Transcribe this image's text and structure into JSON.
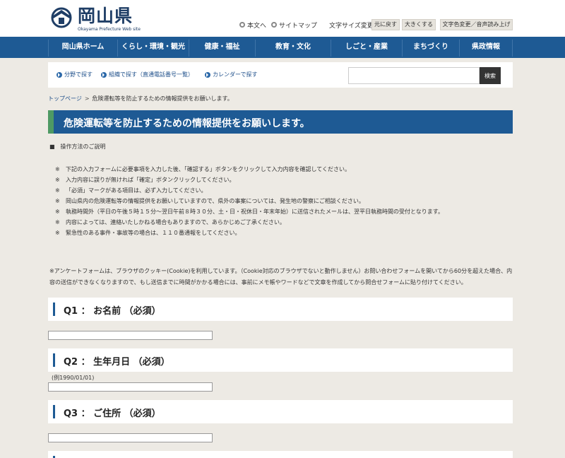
{
  "header": {
    "logo_title": "岡山県",
    "logo_subtitle": "Okayama Prefecture Web site",
    "links": {
      "main_text": "本文へ",
      "sitemap": "サイトマップ"
    },
    "font_size_label": "文字サイズ変更",
    "buttons": {
      "reset": "元に戻す",
      "enlarge": "大きくする",
      "color_voice": "文字色変更／音声読み上げ"
    }
  },
  "nav": [
    "岡山県ホーム",
    "くらし・環境・観光",
    "健康・福祉",
    "教育・文化",
    "しごと・産業",
    "まちづくり",
    "県政情報"
  ],
  "search": {
    "links": [
      "分野で探す",
      "組織で探す（直通電話番号一覧）",
      "カレンダーで探す"
    ],
    "placeholder": "",
    "button": "検索"
  },
  "breadcrumb": {
    "home": "トップページ",
    "separator": ">",
    "current": "危険運転等を防止するための情報提供をお願いします。"
  },
  "title": "危険運転等を防止するための情報提供をお願いします。",
  "instructions": {
    "heading": "■　操作方法のご説明",
    "mark": "※",
    "notes": [
      "下記の入力フォームに必要事項を入力した後、「確認する」ボタンをクリックして入力内容を確認してください。",
      "入力内容に誤りが無ければ「確定」ボタンクリックしてください。",
      "「必須」マークがある項目は、必ず入力してください。",
      "岡山県内の危険運転等の情報提供をお願いしていますので、県外の事案については、発生地の警察にご相談ください。",
      "執務時間外（平日の午後５時１５分～翌日午前８時３０分、土・日・祝休日・年末年始）に送信されたメールは、翌平日執務時間の受付となります。",
      "内容によっては、連絡いたしかねる場合もありますので、あらかじめご了承ください。",
      "緊急性のある事件・事故等の場合は、１１０番通報をしてください。"
    ],
    "cookie": "※アンケートフォームは、ブラウザのクッキー(Cookie)を利用しています。（Cookie対応のブラウザでないと動作しません）お問い合わせフォームを開いてから60分を超えた場合、内容の送信ができなくなりますので、もし送信までに時間がかかる場合には、事前にメモ帳やワードなどで文章を作成してから問合せフォームに貼り付けてください。"
  },
  "questions": [
    {
      "label": "Q1 ： お名前 （必須）"
    },
    {
      "label": "Q2 ： 生年月日 （必須）",
      "example": "(例1990/01/01)"
    },
    {
      "label": "Q3 ： ご住所 （必須）"
    }
  ],
  "colors": {
    "nav_blue": "#1e5a94",
    "title_accent_green": "#4e9a64",
    "page_bg": "#edeae4"
  }
}
